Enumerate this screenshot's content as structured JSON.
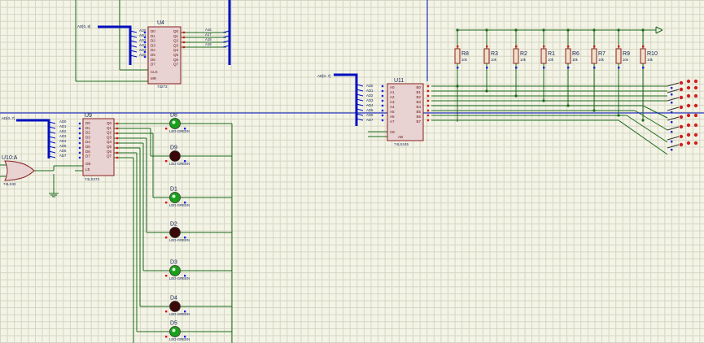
{
  "chips": {
    "u4": {
      "ref": "U4",
      "part": "74273",
      "pins_left": [
        "D0",
        "D1",
        "D2",
        "D3",
        "D4",
        "D5",
        "D6",
        "D7"
      ],
      "pins_right": [
        "Q0",
        "Q1",
        "Q2",
        "Q3",
        "Q4",
        "Q5",
        "Q6",
        "Q7"
      ],
      "clk": "CLK",
      "mr": "MR"
    },
    "u9": {
      "ref": "U9",
      "part": "74LS373",
      "pins_left": [
        "D0",
        "D1",
        "D2",
        "D3",
        "D4",
        "D5",
        "D6",
        "D7"
      ],
      "pins_right": [
        "Q0",
        "Q1",
        "Q2",
        "Q3",
        "Q4",
        "Q5",
        "Q6",
        "Q7"
      ],
      "oe": "OE",
      "le": "LE"
    },
    "u11": {
      "ref": "U11",
      "part": "74LS245",
      "pins_left": [
        "A0",
        "A1",
        "A2",
        "A3",
        "A4",
        "A5",
        "A6",
        "A7"
      ],
      "pins_right": [
        "B0",
        "B1",
        "B2",
        "B3",
        "B4",
        "B5",
        "B6",
        "B7"
      ],
      "ce": "CE",
      "ab": "AB"
    },
    "u10": {
      "ref": "U10:A",
      "part": "74LS32"
    }
  },
  "bus_labels": {
    "u4_in": "AD[0..8]",
    "u4_out": [
      "A16",
      "A17",
      "A18",
      "A19"
    ],
    "u9_in": "AD[0..7]",
    "u11_in": "AD[0..7]",
    "u9_pin_nets": [
      "AD0",
      "AD1",
      "AD2",
      "AD3",
      "AD4",
      "AD5",
      "AD6",
      "AD7"
    ],
    "u11_pin_nets": [
      "AD0",
      "AD1",
      "AD2",
      "AD3",
      "AD4",
      "AD5",
      "AD6",
      "AD7"
    ],
    "u4_pin_nets": [
      "AD0",
      "AD1",
      "AD2",
      "AD3",
      "AD4",
      "AD5",
      "AD6",
      "AD7"
    ]
  },
  "leds": [
    {
      "ref": "D8",
      "part": "LED-GREEN",
      "lit": true
    },
    {
      "ref": "D9",
      "part": "LED-GREEN",
      "lit": false
    },
    {
      "ref": "D1",
      "part": "LED-GREEN",
      "lit": true
    },
    {
      "ref": "D2",
      "part": "LED-GREEN",
      "lit": false
    },
    {
      "ref": "D3",
      "part": "LED-GREEN",
      "lit": true
    },
    {
      "ref": "D4",
      "part": "LED-GREEN",
      "lit": false
    },
    {
      "ref": "D5",
      "part": "LED-GREEN",
      "lit": true
    }
  ],
  "resistors": [
    {
      "ref": "R8",
      "value": "10k"
    },
    {
      "ref": "R3",
      "value": "10k"
    },
    {
      "ref": "R2",
      "value": "10k"
    },
    {
      "ref": "R1",
      "value": "10k"
    },
    {
      "ref": "R6",
      "value": "10k"
    },
    {
      "ref": "R7",
      "value": "10k"
    },
    {
      "ref": "R9",
      "value": "10k"
    },
    {
      "ref": "R10",
      "value": "10k"
    }
  ],
  "colors": {
    "wire": "#1a6a1a",
    "bus": "#0010c0",
    "chip_fill": "#e8d2d2",
    "chip_border": "#8b2020",
    "led_on": "#1aa01a",
    "led_off": "#3a0808",
    "pin_red": "#e01010",
    "pin_blue": "#2020e0"
  }
}
